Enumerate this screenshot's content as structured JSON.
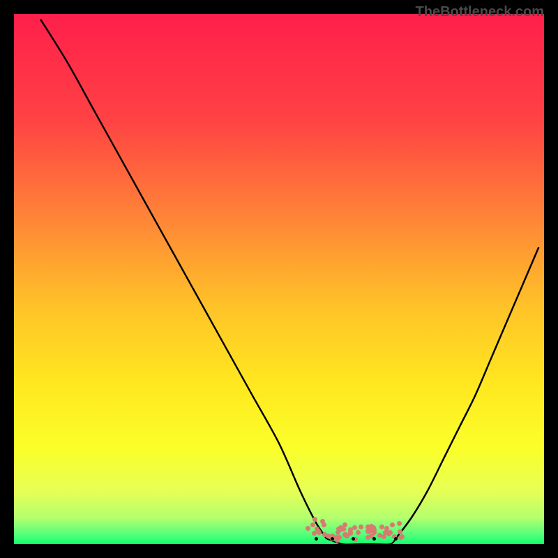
{
  "watermark": "TheBottleneck.com",
  "gradient_stops": [
    {
      "offset": "0%",
      "color": "#ff1f4b"
    },
    {
      "offset": "20%",
      "color": "#ff4244"
    },
    {
      "offset": "40%",
      "color": "#ff8a36"
    },
    {
      "offset": "55%",
      "color": "#ffc228"
    },
    {
      "offset": "70%",
      "color": "#ffe81f"
    },
    {
      "offset": "82%",
      "color": "#fbff2a"
    },
    {
      "offset": "90%",
      "color": "#e6ff55"
    },
    {
      "offset": "95%",
      "color": "#b4ff6e"
    },
    {
      "offset": "98%",
      "color": "#5aff7a"
    },
    {
      "offset": "100%",
      "color": "#12ff6f"
    }
  ],
  "chart_data": {
    "type": "line",
    "title": "",
    "xlabel": "",
    "ylabel": "",
    "xlim": [
      0,
      100
    ],
    "ylim": [
      0,
      100
    ],
    "series": [
      {
        "name": "left-curve",
        "x": [
          5,
          10,
          15,
          20,
          25,
          30,
          35,
          40,
          45,
          50,
          54,
          57,
          59
        ],
        "values": [
          99,
          91,
          82,
          73,
          64,
          55,
          46,
          37,
          28,
          19,
          10,
          4,
          1
        ]
      },
      {
        "name": "right-curve",
        "x": [
          72,
          75,
          78,
          81,
          84,
          87,
          90,
          93,
          96,
          99
        ],
        "values": [
          1,
          5,
          10,
          16,
          22,
          28,
          35,
          42,
          49,
          56
        ]
      },
      {
        "name": "valley-floor",
        "x": [
          59,
          62,
          65,
          68,
          71,
          72
        ],
        "values": [
          1,
          0,
          0,
          0,
          0,
          1
        ]
      }
    ],
    "scatter_band": {
      "name": "valley-scatter",
      "color": "#d87a72",
      "x_range": [
        56,
        73
      ],
      "y_range": [
        0,
        3.5
      ],
      "count": 60
    },
    "tick_marks": {
      "y_bottom": 1,
      "x_positions": [
        57,
        60,
        64,
        68,
        72
      ]
    }
  }
}
